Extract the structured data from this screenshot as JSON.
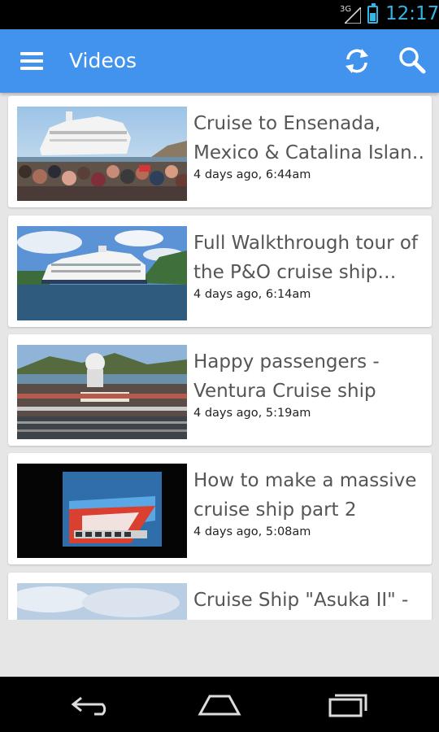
{
  "status_bar": {
    "network": "3G",
    "time": "12:17"
  },
  "app_bar": {
    "title": "Videos",
    "menu_icon": "hamburger-menu-icon",
    "refresh_icon": "refresh-icon",
    "search_icon": "search-icon",
    "color": "#4193ee"
  },
  "videos": [
    {
      "title_line1": "Cruise to Ensenada,",
      "title_line2": "Mexico & Catalina Islan…",
      "meta": "4 days ago, 6:44am"
    },
    {
      "title_line1": "Full Walkthrough tour of",
      "title_line2": "the P&O cruise ship…",
      "meta": "4 days ago, 6:14am"
    },
    {
      "title_line1": "Happy passengers -",
      "title_line2": "Ventura Cruise ship",
      "meta": "4 days ago, 5:19am"
    },
    {
      "title_line1": "How to make a massive",
      "title_line2": "cruise ship part 2",
      "meta": "4 days ago, 5:08am"
    },
    {
      "title_line1": "Cruise Ship \"Asuka II\" -",
      "title_line2": "",
      "meta": ""
    }
  ],
  "nav": {
    "back_icon": "back-icon",
    "home_icon": "home-icon",
    "recents_icon": "recent-apps-icon"
  }
}
